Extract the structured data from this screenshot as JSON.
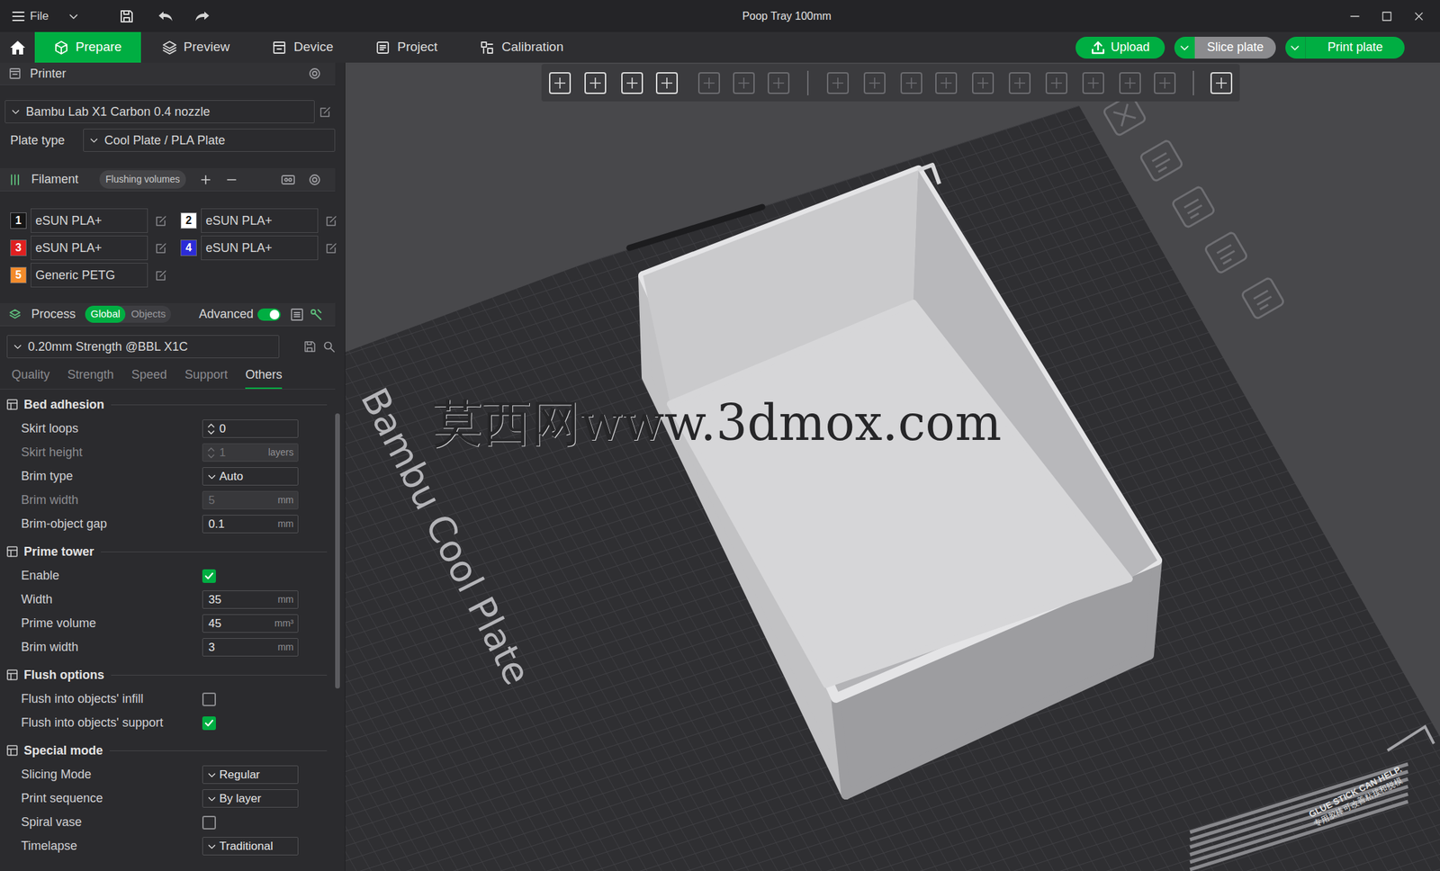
{
  "window": {
    "title": "Poop Tray 100mm",
    "menu": "File"
  },
  "tabs": [
    {
      "label": "Prepare",
      "selected": true
    },
    {
      "label": "Preview",
      "selected": false
    },
    {
      "label": "Device",
      "selected": false
    },
    {
      "label": "Project",
      "selected": false
    },
    {
      "label": "Calibration",
      "selected": false
    }
  ],
  "actions": [
    {
      "label": "Upload"
    },
    {
      "label": "Slice plate"
    },
    {
      "label": "Print plate"
    }
  ],
  "printer": {
    "title": "Printer",
    "preset": "Bambu Lab X1 Carbon 0.4 nozzle",
    "plate_type_label": "Plate type",
    "plate_type": "Cool Plate / PLA Plate"
  },
  "filament": {
    "title": "Filament",
    "flushing_button": "Flushing volumes",
    "items": [
      {
        "number": "1",
        "name": "eSUN PLA+",
        "color": "#161616"
      },
      {
        "number": "2",
        "name": "eSUN PLA+",
        "color": "#ffffff"
      },
      {
        "number": "3",
        "name": "eSUN PLA+",
        "color": "#e02020"
      },
      {
        "number": "4",
        "name": "eSUN PLA+",
        "color": "#2c2cd8"
      },
      {
        "number": "5",
        "name": "Generic PETG",
        "color": "#f28b2c"
      }
    ]
  },
  "process": {
    "title": "Process",
    "scope": [
      {
        "label": "Global",
        "selected": true
      },
      {
        "label": "Objects",
        "selected": false
      }
    ],
    "advanced_label": "Advanced",
    "advanced": true,
    "preset": "0.20mm Strength @BBL X1C",
    "tabs": [
      {
        "label": "Quality",
        "selected": false
      },
      {
        "label": "Strength",
        "selected": false
      },
      {
        "label": "Speed",
        "selected": false
      },
      {
        "label": "Support",
        "selected": false
      },
      {
        "label": "Others",
        "selected": true
      }
    ]
  },
  "sections": [
    {
      "title": "Bed adhesion",
      "rows": [
        {
          "label": "Skirt loops",
          "kind": "spin",
          "value": "0",
          "disabled": false
        },
        {
          "label": "Skirt height",
          "kind": "spin",
          "value": "1",
          "unit": "layers",
          "disabled": true
        },
        {
          "label": "Brim type",
          "kind": "select",
          "value": "Auto",
          "disabled": false
        },
        {
          "label": "Brim width",
          "kind": "text",
          "value": "5",
          "unit": "mm",
          "disabled": true
        },
        {
          "label": "Brim-object gap",
          "kind": "text",
          "value": "0.1",
          "unit": "mm",
          "disabled": false
        }
      ]
    },
    {
      "title": "Prime tower",
      "rows": [
        {
          "label": "Enable",
          "kind": "checkbox",
          "checked": true,
          "disabled": false
        },
        {
          "label": "Width",
          "kind": "text",
          "value": "35",
          "unit": "mm",
          "disabled": false
        },
        {
          "label": "Prime volume",
          "kind": "text",
          "value": "45",
          "unit": "mm³",
          "disabled": false
        },
        {
          "label": "Brim width",
          "kind": "text",
          "value": "3",
          "unit": "mm",
          "disabled": false
        }
      ]
    },
    {
      "title": "Flush options",
      "rows": [
        {
          "label": "Flush into objects' infill",
          "kind": "checkbox",
          "checked": false,
          "disabled": false
        },
        {
          "label": "Flush into objects' support",
          "kind": "checkbox",
          "checked": true,
          "disabled": false
        }
      ]
    },
    {
      "title": "Special mode",
      "rows": [
        {
          "label": "Slicing Mode",
          "kind": "select",
          "value": "Regular",
          "disabled": false
        },
        {
          "label": "Print sequence",
          "kind": "select",
          "value": "By layer",
          "disabled": false
        },
        {
          "label": "Spiral vase",
          "kind": "checkbox",
          "checked": false,
          "disabled": false
        },
        {
          "label": "Timelapse",
          "kind": "select",
          "value": "Traditional",
          "disabled": false
        }
      ]
    }
  ],
  "viewport": {
    "plate_label": "Bambu Cool Plate",
    "notice": "GLUE STICK CAN HELP.",
    "notice_cn": "专用胶棒可改善粘接和脱模"
  },
  "watermark": "莫西网www.3dmox.com"
}
